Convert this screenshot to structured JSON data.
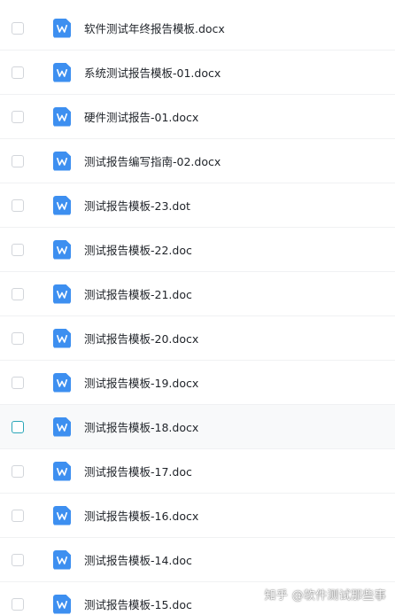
{
  "files": [
    {
      "name": "软件测试年终报告模板.docx",
      "icon": "word-doc-icon"
    },
    {
      "name": "系统测试报告模板-01.docx",
      "icon": "word-doc-icon"
    },
    {
      "name": "硬件测试报告-01.docx",
      "icon": "word-doc-icon"
    },
    {
      "name": "测试报告编写指南-02.docx",
      "icon": "word-doc-icon"
    },
    {
      "name": "测试报告模板-23.dot",
      "icon": "word-doc-icon"
    },
    {
      "name": "测试报告模板-22.doc",
      "icon": "word-doc-icon"
    },
    {
      "name": "测试报告模板-21.doc",
      "icon": "word-doc-icon"
    },
    {
      "name": "测试报告模板-20.docx",
      "icon": "word-doc-icon"
    },
    {
      "name": "测试报告模板-19.docx",
      "icon": "word-doc-icon"
    },
    {
      "name": "测试报告模板-18.docx",
      "icon": "word-doc-icon",
      "hovered": true
    },
    {
      "name": "测试报告模板-17.doc",
      "icon": "word-doc-icon"
    },
    {
      "name": "测试报告模板-16.docx",
      "icon": "word-doc-icon"
    },
    {
      "name": "测试报告模板-14.doc",
      "icon": "word-doc-icon"
    },
    {
      "name": "测试报告模板-15.doc",
      "icon": "word-doc-icon"
    }
  ],
  "watermark": "知乎 @软件测试那些事",
  "colors": {
    "icon_blue": "#3d8ff0",
    "hover_checkbox": "#2aa6b8",
    "text": "#1f2329"
  }
}
